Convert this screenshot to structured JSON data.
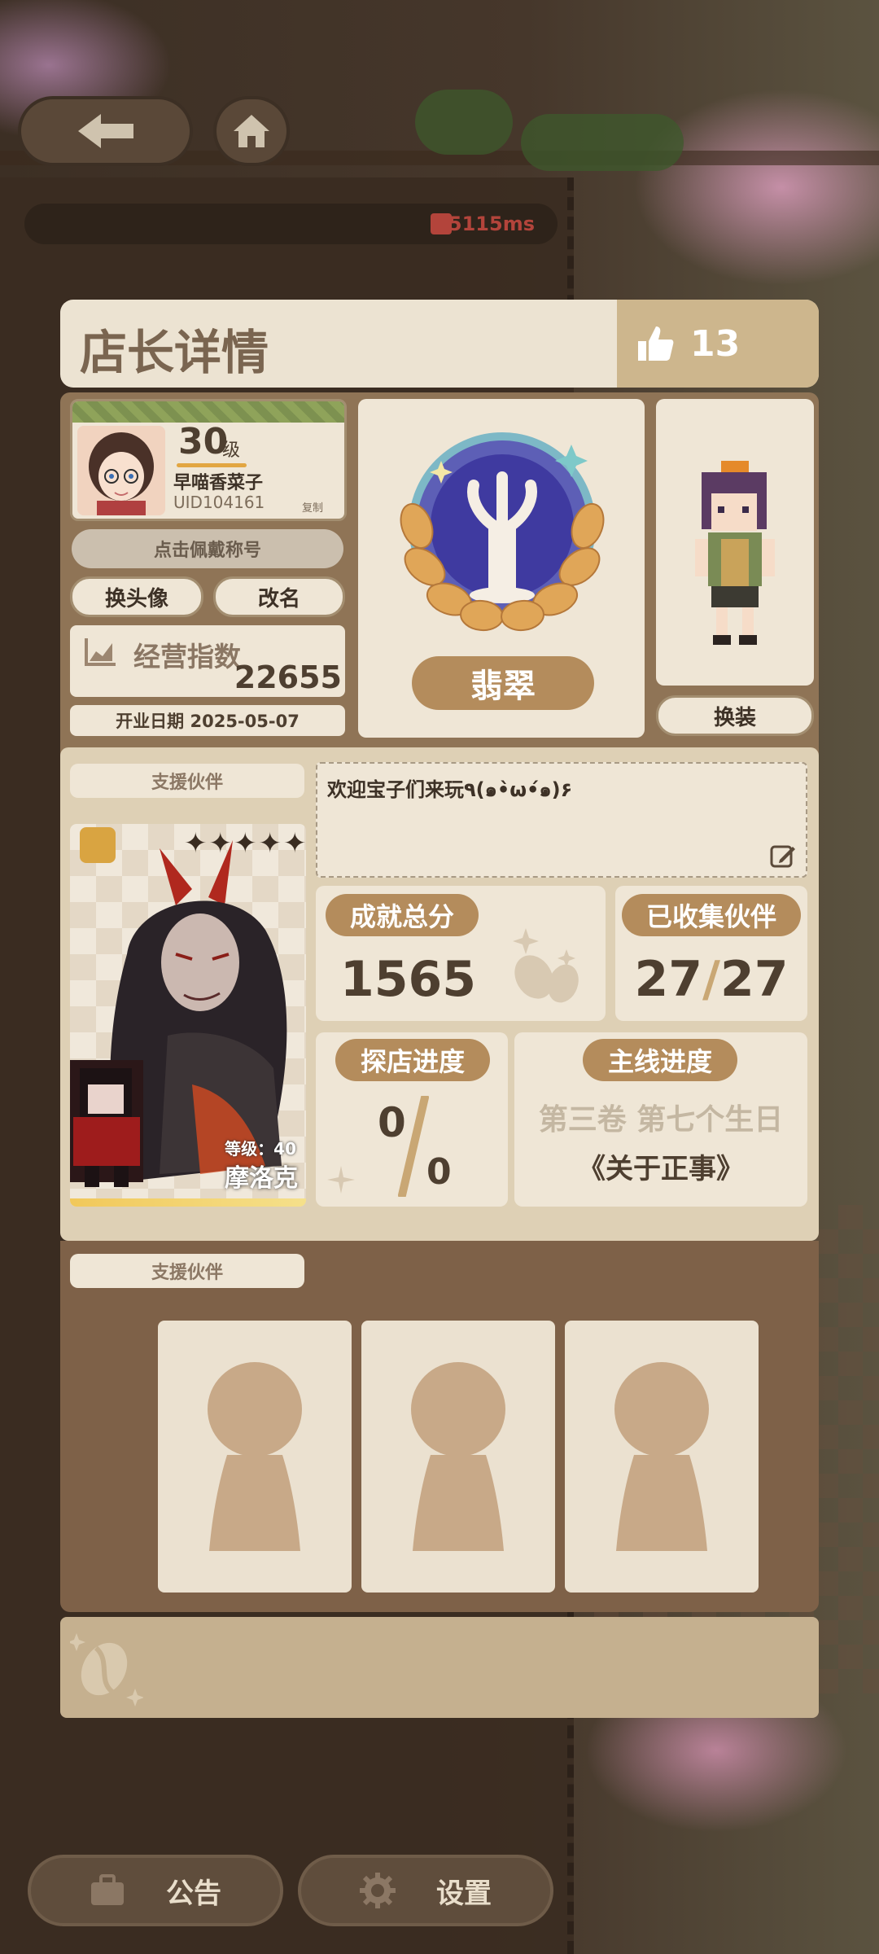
{
  "hud": {
    "ping": "5115ms",
    "back_icon": "back-arrow-icon",
    "home_icon": "home-icon"
  },
  "header": {
    "title": "店长详情",
    "like_count": "13"
  },
  "profile": {
    "level": "30",
    "level_unit": "级",
    "name": "早喵香菜子",
    "uid": "UID104161",
    "copy_label": "复制",
    "title_button": "点击佩戴称号",
    "change_avatar": "换头像",
    "rename": "改名",
    "business_label": "经营指数",
    "business_value": "22655",
    "open_date": "开业日期 2025-05-07"
  },
  "badge": {
    "name": "翡翠"
  },
  "character": {
    "outfit_button": "换装"
  },
  "partner": {
    "section_label": "支援伙伴",
    "stars": "✦✦✦✦✦",
    "level_text": "等级：40",
    "name": "摩洛克"
  },
  "motto": {
    "text": "欢迎宝子们来玩٩(๑•̀ω•́๑)۶"
  },
  "stats": {
    "achievement_label": "成就总分",
    "achievement_value": "1565",
    "collected_label": "已收集伙伴",
    "collected_value": "27",
    "collected_slash": "/",
    "collected_total": "27",
    "explore_label": "探店进度",
    "explore_value": "0",
    "explore_total": "0",
    "story_label": "主线进度",
    "story_chapter": "第三卷 第七个生日",
    "story_title": "《关于正事》"
  },
  "support": {
    "section_label": "支援伙伴"
  },
  "footer": {
    "notice": "公告",
    "settings": "设置"
  },
  "colors": {
    "accent": "#b48c5c",
    "card": "#efe6d6",
    "text_dark": "#4e3f30",
    "ping_red": "#b3443b"
  }
}
